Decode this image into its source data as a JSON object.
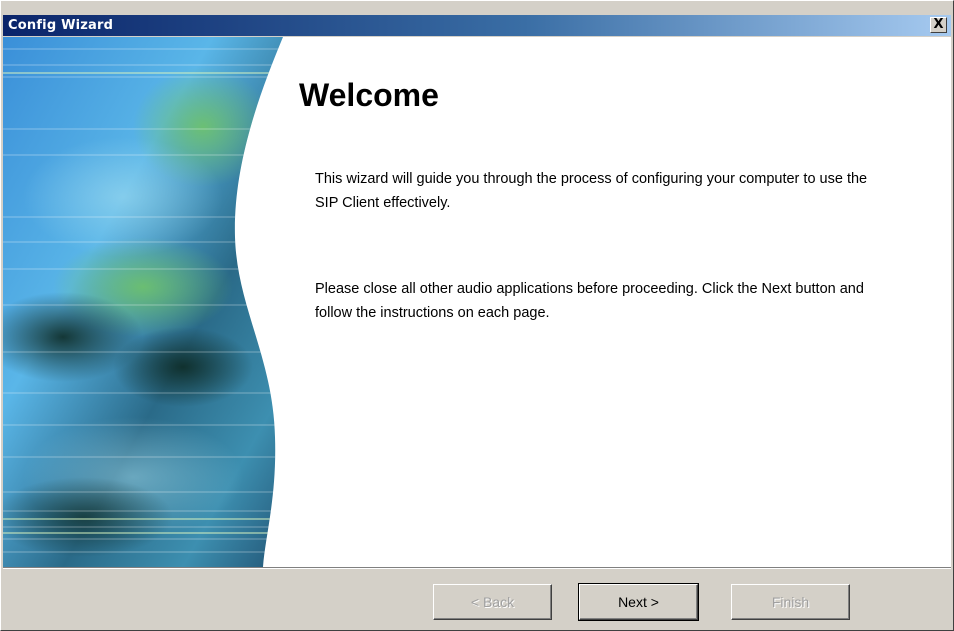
{
  "window": {
    "title": "Config Wizard",
    "close_label": "X"
  },
  "page": {
    "heading": "Welcome",
    "paragraph1": "This wizard will guide you through the process of configuring your computer to use the SIP Client effectively.",
    "paragraph2": "Please close all other audio applications before proceeding. Click the Next button and follow the instructions on each page."
  },
  "buttons": {
    "back": "< Back",
    "next": "Next >",
    "finish": "Finish"
  },
  "colors": {
    "titlebar_start": "#0a246a",
    "titlebar_end": "#a6caf0",
    "dialog_face": "#d4d0c8"
  }
}
